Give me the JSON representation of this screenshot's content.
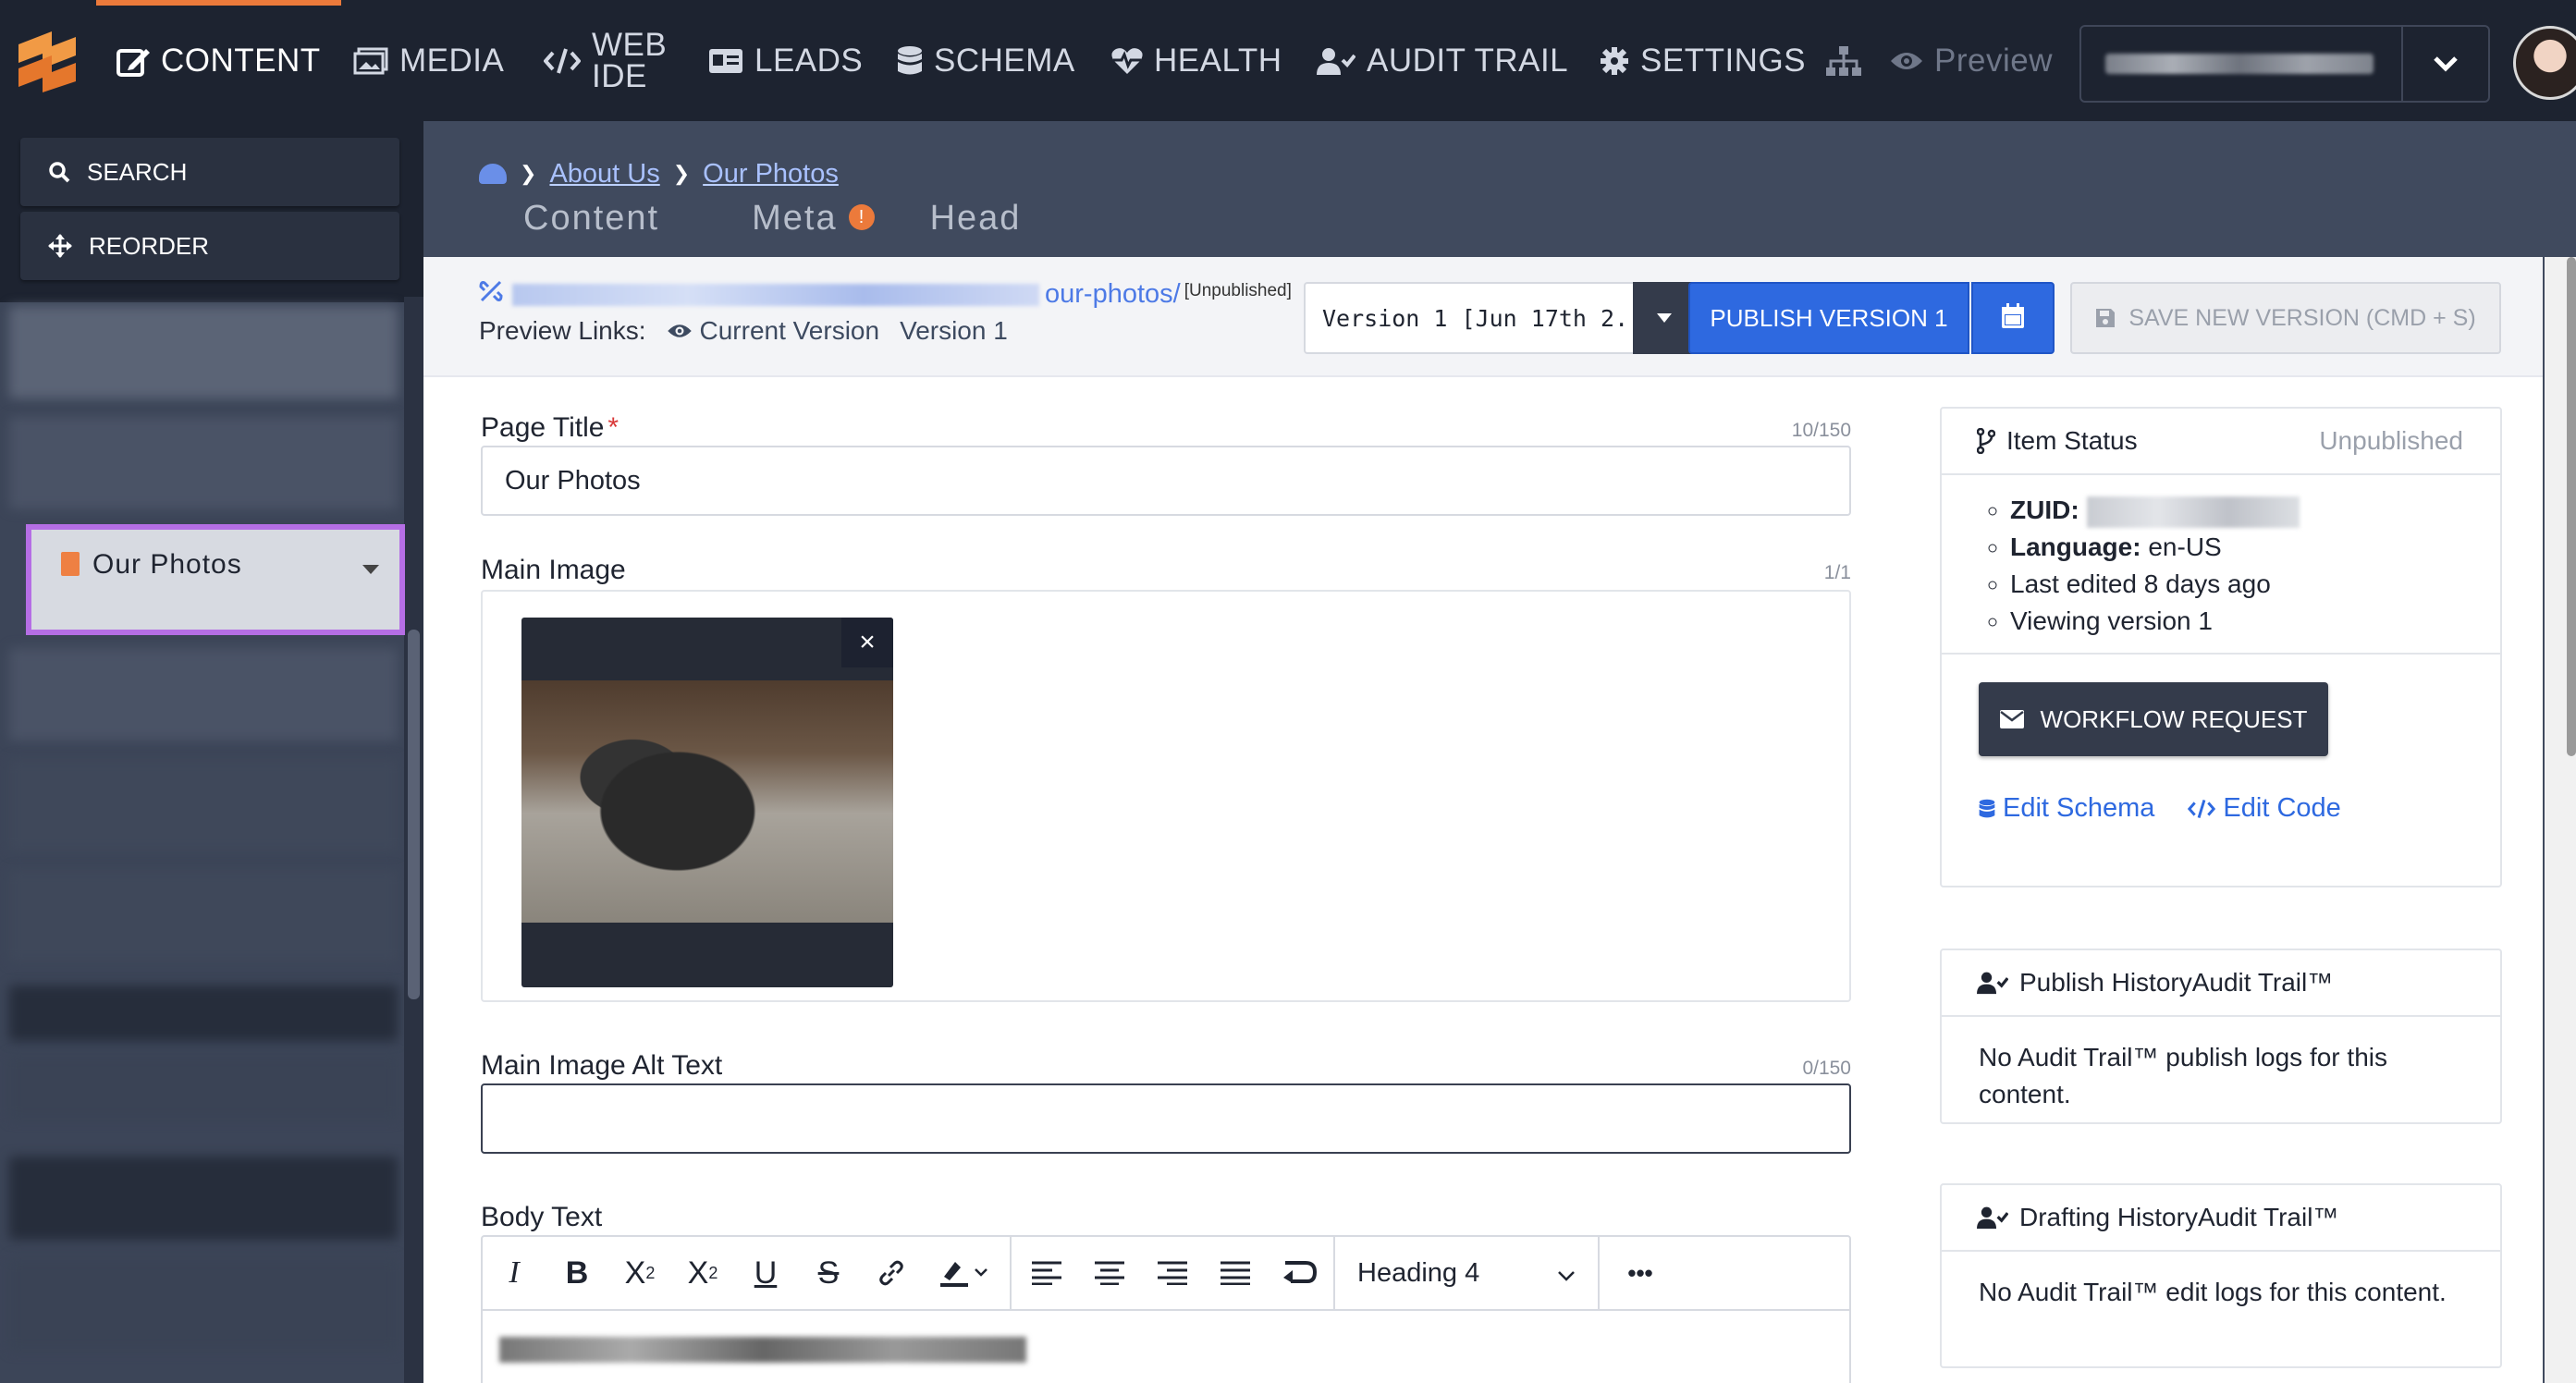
{
  "nav": {
    "items": [
      {
        "label": "CONTENT",
        "icon": "edit-icon"
      },
      {
        "label": "MEDIA",
        "icon": "images-icon"
      },
      {
        "label": "WEB",
        "label2": "IDE",
        "icon": "code-icon"
      },
      {
        "label": "LEADS",
        "icon": "id-card-icon"
      },
      {
        "label": "SCHEMA",
        "icon": "database-icon"
      },
      {
        "label": "HEALTH",
        "icon": "heartbeat-icon"
      },
      {
        "label": "AUDIT TRAIL",
        "icon": "user-check-icon"
      },
      {
        "label": "SETTINGS",
        "icon": "gear-icon"
      }
    ],
    "preview": "Preview",
    "accent": "#ec7a3b"
  },
  "sidebar": {
    "search": "SEARCH",
    "reorder": "REORDER",
    "active_item": "Our Photos",
    "active_outline": "#b56ee5"
  },
  "breadcrumb": {
    "items": [
      "About Us",
      "Our Photos"
    ]
  },
  "tabs": {
    "content": "Content",
    "meta": "Meta",
    "meta_badge": "!",
    "head": "Head"
  },
  "urlbar": {
    "url_suffix": "our-photos/",
    "status": "[Unpublished]",
    "preview_label": "Preview Links:",
    "current_version": "Current Version",
    "version_link": "Version 1"
  },
  "actions": {
    "version_select": "Version 1 [Jun 17th 2...",
    "publish": "PUBLISH VERSION 1",
    "save": "SAVE NEW VERSION (CMD + S)"
  },
  "fields": {
    "page_title": {
      "label": "Page Title",
      "required": "*",
      "count": "10/150",
      "value": "Our Photos"
    },
    "main_image": {
      "label": "Main Image",
      "count": "1/1",
      "remove": "×"
    },
    "alt_text": {
      "label": "Main Image Alt Text",
      "count": "0/150",
      "value": ""
    },
    "body_text": {
      "label": "Body Text",
      "heading_select": "Heading 4",
      "more": "•••"
    }
  },
  "item_status": {
    "title": "Item Status",
    "state": "Unpublished",
    "zuid_label": "ZUID:",
    "language_label": "Language:",
    "language": "en-US",
    "last_edited": "Last edited 8 days ago",
    "viewing": "Viewing version 1",
    "workflow": "WORKFLOW REQUEST",
    "edit_schema": "Edit Schema",
    "edit_code": "Edit Code"
  },
  "publish_history": {
    "title": "Publish HistoryAudit Trail™",
    "body": "No Audit Trail™ publish logs for this content."
  },
  "drafting_history": {
    "title": "Drafting HistoryAudit Trail™",
    "body": "No Audit Trail™ edit logs for this content."
  }
}
